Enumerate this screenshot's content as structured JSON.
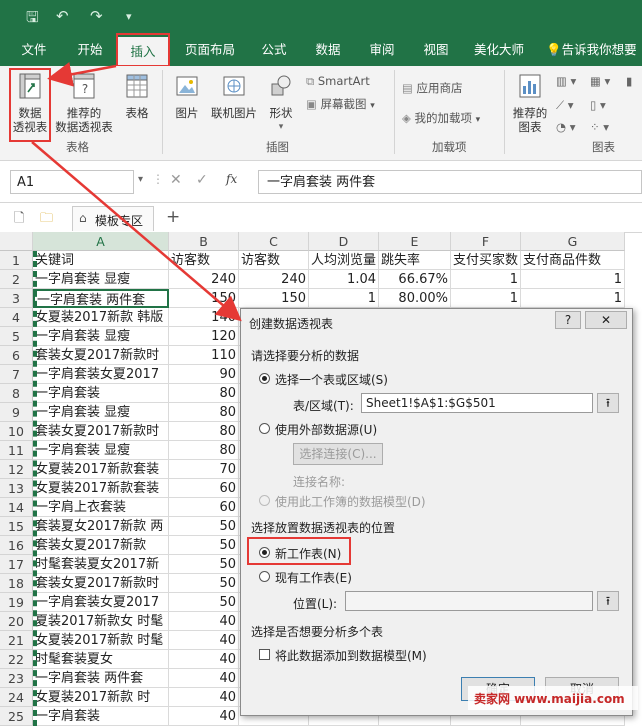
{
  "qat": {
    "save": "🖫",
    "undo": "↶",
    "redo": "↷",
    "more": "▾"
  },
  "ribbon_tabs": [
    "文件",
    "开始",
    "插入",
    "页面布局",
    "公式",
    "数据",
    "审阅",
    "视图",
    "美化大师",
    "告诉我你想要"
  ],
  "ribbon": {
    "pivot_table": "数据\n透视表",
    "recommended_pivot": "推荐的\n数据透视表",
    "table": "表格",
    "group_tables": "表格",
    "pictures": "图片",
    "online_pictures": "联机图片",
    "shapes": "形状",
    "smartart": "SmartArt",
    "screenshot": "屏幕截图",
    "group_illustrations": "插图",
    "store": "应用商店",
    "my_addins": "我的加载项",
    "group_addins": "加载项",
    "recommended_charts": "推荐的\n图表",
    "group_charts": "图表"
  },
  "formula_bar": {
    "name_box": "A1",
    "cancel": "✕",
    "enter": "✓",
    "fx": "fx",
    "content": "一字肩套装 两件套"
  },
  "workbook_tabs": {
    "template_zone": "模板专区",
    "add": "+"
  },
  "grid": {
    "columns": [
      "A",
      "B",
      "C",
      "D",
      "E",
      "F",
      "G"
    ],
    "rows": [
      [
        "关键词",
        "访客数",
        "访客数",
        "人均浏览量",
        "跳失率",
        "支付买家数",
        "支付商品件数"
      ],
      [
        "一字肩套装 显瘦",
        "240",
        "240",
        "1.04",
        "66.67%",
        "1",
        "1"
      ],
      [
        "一字肩套装 两件套",
        "150",
        "150",
        "1",
        "80.00%",
        "1",
        "1"
      ],
      [
        "女夏装2017新款 韩版",
        "140",
        "",
        "",
        "",
        "",
        ""
      ],
      [
        "一字肩套装 显瘦",
        "120",
        "",
        "",
        "",
        "",
        ""
      ],
      [
        "套装女夏2017新款时",
        "110",
        "",
        "",
        "",
        "",
        ""
      ],
      [
        "一字肩套装女夏2017",
        "90",
        "",
        "",
        "",
        "",
        ""
      ],
      [
        "一字肩套装",
        "80",
        "",
        "",
        "",
        "",
        ""
      ],
      [
        "一字肩套装  显瘦",
        "80",
        "",
        "",
        "",
        "",
        ""
      ],
      [
        "套装女夏2017新款时",
        "80",
        "",
        "",
        "",
        "",
        ""
      ],
      [
        "一字肩套装  显瘦",
        "80",
        "",
        "",
        "",
        "",
        ""
      ],
      [
        "女夏装2017新款套装",
        "70",
        "",
        "",
        "",
        "",
        ""
      ],
      [
        "女夏装2017新款套装",
        "60",
        "",
        "",
        "",
        "",
        ""
      ],
      [
        "一字肩上衣套装",
        "60",
        "",
        "",
        "",
        "",
        ""
      ],
      [
        "套装夏女2017新款 两",
        "50",
        "",
        "",
        "",
        "",
        ""
      ],
      [
        "套装女夏2017新款",
        "50",
        "",
        "",
        "",
        "",
        ""
      ],
      [
        "时髦套装夏女2017新",
        "50",
        "",
        "",
        "",
        "",
        ""
      ],
      [
        "套装女夏2017新款时",
        "50",
        "",
        "",
        "",
        "",
        ""
      ],
      [
        "一字肩套装女夏2017",
        "50",
        "",
        "",
        "",
        "",
        ""
      ],
      [
        "夏装2017新款女 时髦",
        "40",
        "",
        "",
        "",
        "",
        ""
      ],
      [
        "女夏装2017新款 时髦",
        "40",
        "",
        "",
        "",
        "",
        ""
      ],
      [
        "时髦套装夏女",
        "40",
        "",
        "",
        "",
        "",
        ""
      ],
      [
        "一字肩套装  两件套",
        "40",
        "",
        "",
        "",
        "",
        ""
      ],
      [
        "女夏装2017新款  时",
        "40",
        "",
        "",
        "",
        "",
        ""
      ],
      [
        "一字肩套装",
        "40",
        "",
        "",
        "",
        "",
        ""
      ]
    ]
  },
  "dialog": {
    "title": "创建数据透视表",
    "help": "?",
    "close": "✕",
    "section_data": "请选择要分析的数据",
    "opt_range": "选择一个表或区域(S)",
    "label_range": "表/区域(T):",
    "range_value": "Sheet1!$A$1:$G$501",
    "opt_external": "使用外部数据源(U)",
    "choose_connection": "选择连接(C)...",
    "connection_name": "连接名称:",
    "opt_datamodel": "使用此工作簿的数据模型(D)",
    "section_location": "选择放置数据透视表的位置",
    "opt_new_sheet": "新工作表(N)",
    "opt_existing_sheet": "现有工作表(E)",
    "label_location": "位置(L):",
    "section_multi": "选择是否想要分析多个表",
    "add_to_model": "将此数据添加到数据模型(M)",
    "ok": "确定",
    "cancel": "取消"
  },
  "watermark": "卖家网 www.maijia.com",
  "colors": {
    "excel_green": "#217346",
    "annotation_red": "#e53935"
  }
}
